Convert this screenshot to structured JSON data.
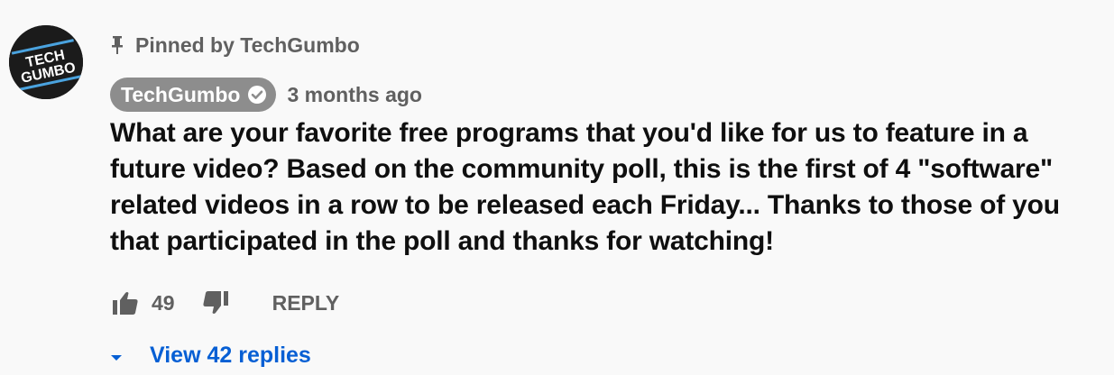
{
  "pinned": {
    "label": "Pinned by TechGumbo",
    "icon": "pin-icon"
  },
  "avatar": {
    "line1": "TECH",
    "line2": "GUMBO",
    "colors": {
      "background": "#1b1b1b",
      "stripe": "#4aa3df",
      "text": "#ffffff"
    }
  },
  "author": {
    "name": "TechGumbo",
    "verified_icon": "verified-check-icon",
    "time": "3 months ago"
  },
  "comment": {
    "text": "What are your favorite free programs that you'd like for us to feature in a future video? Based on the community poll, this is the first of 4 \"software\" related videos in a row to be released each Friday... Thanks to those of you that participated in the poll and thanks for watching!"
  },
  "actions": {
    "like_icon": "thumbs-up-icon",
    "like_count": "49",
    "dislike_icon": "thumbs-down-icon",
    "reply_label": "REPLY"
  },
  "replies": {
    "caret_icon": "caret-down-icon",
    "label": "View 42 replies"
  },
  "colors": {
    "background": "#f9f9f9",
    "secondary_text": "#606060",
    "primary_text": "#0f0f0f",
    "author_chip": "#8d8d8d",
    "link_blue": "#065fd4"
  }
}
